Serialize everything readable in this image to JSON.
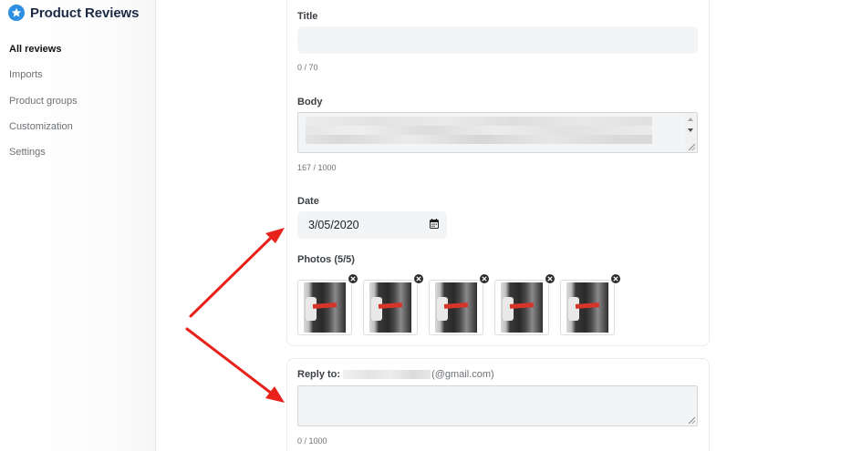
{
  "sidebar": {
    "brand_title": "Product Reviews",
    "items": [
      {
        "label": "All reviews",
        "active": true
      },
      {
        "label": "Imports",
        "active": false
      },
      {
        "label": "Product groups",
        "active": false
      },
      {
        "label": "Customization",
        "active": false
      },
      {
        "label": "Settings",
        "active": false
      }
    ]
  },
  "form": {
    "title": {
      "label": "Title",
      "value": "",
      "counter": "0 / 70"
    },
    "body": {
      "label": "Body",
      "counter": "167 / 1000"
    },
    "date": {
      "label": "Date",
      "value": "3/05/2020"
    },
    "photos": {
      "label": "Photos (5/5)",
      "count": 5
    },
    "reply": {
      "label": "Reply to:",
      "email_suffix": "(@gmail.com)",
      "value": "",
      "counter": "0 / 1000"
    }
  },
  "colors": {
    "brand_blue": "#2e8fe2",
    "annotation_red": "#e8211a",
    "photo_accent": "#d8352a"
  },
  "icons": [
    "star-icon",
    "calendar-icon",
    "remove-photo-icon",
    "scroll-arrow-icon",
    "resize-grip-icon"
  ]
}
